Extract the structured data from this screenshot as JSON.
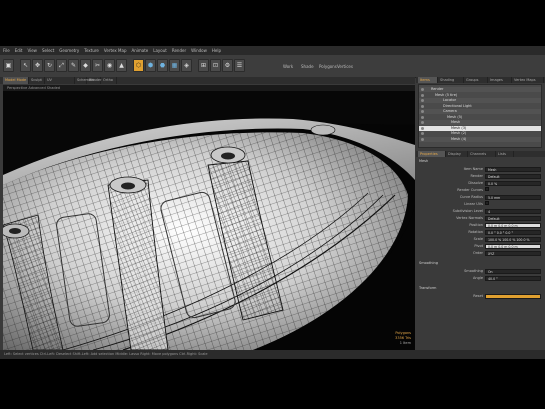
{
  "menu": [
    "File",
    "Edit",
    "View",
    "Select",
    "Geometry",
    "Texture",
    "Vertex Map",
    "Animate",
    "Layout",
    "Render",
    "Window",
    "Help"
  ],
  "toolbar": {
    "labels": [
      "Work",
      "Shade",
      "Polygons",
      "Vertices"
    ],
    "buttons": [
      "▣",
      "↖",
      "✥",
      "↻",
      "⤢",
      "✎",
      "◆",
      "✂",
      "◉",
      "▲",
      "⬡",
      "⬢",
      "⬣",
      "▦",
      "◈",
      "⊞",
      "⊡",
      "⚙",
      "☰"
    ]
  },
  "viewport_tabs": [
    "Model Mode",
    "Sculpt",
    "UV",
    "Schematic",
    "Render",
    "Ortho"
  ],
  "viewport": {
    "header": "Perspective      Advanced Shaded",
    "info_lines": [
      "Polygons",
      "3356 Tris",
      "1 Item"
    ]
  },
  "status_bar": "Left: Select vertices  Ctrl-Left: Deselect  Shift-Left: Add selection  Middle: Lasso  Right: Move polygons  Ctrl-Right: Scale",
  "right_tabs": [
    "Items",
    "Shading",
    "Groups",
    "Images",
    "Vertex Maps"
  ],
  "tree": [
    {
      "label": "Render",
      "indent": 2,
      "style": "alt"
    },
    {
      "label": "Mesh (5 tire)",
      "indent": 4,
      "style": ""
    },
    {
      "label": "Locator",
      "indent": 8,
      "style": "alt"
    },
    {
      "label": "Directional Light",
      "indent": 8,
      "style": ""
    },
    {
      "label": "Camera",
      "indent": 8,
      "style": "alt"
    },
    {
      "label": "Mesh (5)",
      "indent": 10,
      "style": ""
    },
    {
      "label": "Mesh",
      "indent": 12,
      "style": "alt"
    },
    {
      "label": "Mesh (3)",
      "indent": 12,
      "style": "sel"
    },
    {
      "label": "Mesh (2)",
      "indent": 12,
      "style": ""
    },
    {
      "label": "Mesh (4)",
      "indent": 12,
      "style": "alt"
    }
  ],
  "prop_tabs": [
    "Properties",
    "Display",
    "Channels",
    "Lists"
  ],
  "properties": {
    "section1": "Mesh",
    "rows": [
      {
        "label": "Item Name",
        "value": "Mesh",
        "style": ""
      },
      {
        "label": "Render",
        "value": "Default",
        "style": ""
      },
      {
        "label": "Dissolve",
        "value": "0.0 %",
        "style": ""
      },
      {
        "label": "Render Curves",
        "value": "",
        "style": "check"
      },
      {
        "label": "Curve Radius",
        "value": "5.0 mm",
        "style": ""
      },
      {
        "label": "Linear UVs",
        "value": "",
        "style": "check"
      },
      {
        "label": "Subdivision Level",
        "value": "4",
        "style": ""
      },
      {
        "label": "Vertex Normals",
        "value": "Default",
        "style": ""
      },
      {
        "label": "Position",
        "value": "0.0 m   0.0 m   0.0 m",
        "style": "light"
      },
      {
        "label": "Rotation",
        "value": "0.0 °   0.0 °   0.0 °",
        "style": ""
      },
      {
        "label": "Scale",
        "value": "100.0 %   100.0 %   100.0 %",
        "style": ""
      },
      {
        "label": "Pivot",
        "value": "0.0 m   0.0 m   0.0 m",
        "style": "light"
      },
      {
        "label": "Order",
        "value": "XYZ",
        "style": ""
      }
    ],
    "section2": "Smoothing",
    "rows2": [
      {
        "label": "Smoothing",
        "value": "On",
        "style": ""
      },
      {
        "label": "Angle",
        "value": "40.0 °",
        "style": ""
      }
    ],
    "section3": "Transform",
    "rows3": [
      {
        "label": "Reset",
        "value": "",
        "style": "orange"
      }
    ]
  }
}
